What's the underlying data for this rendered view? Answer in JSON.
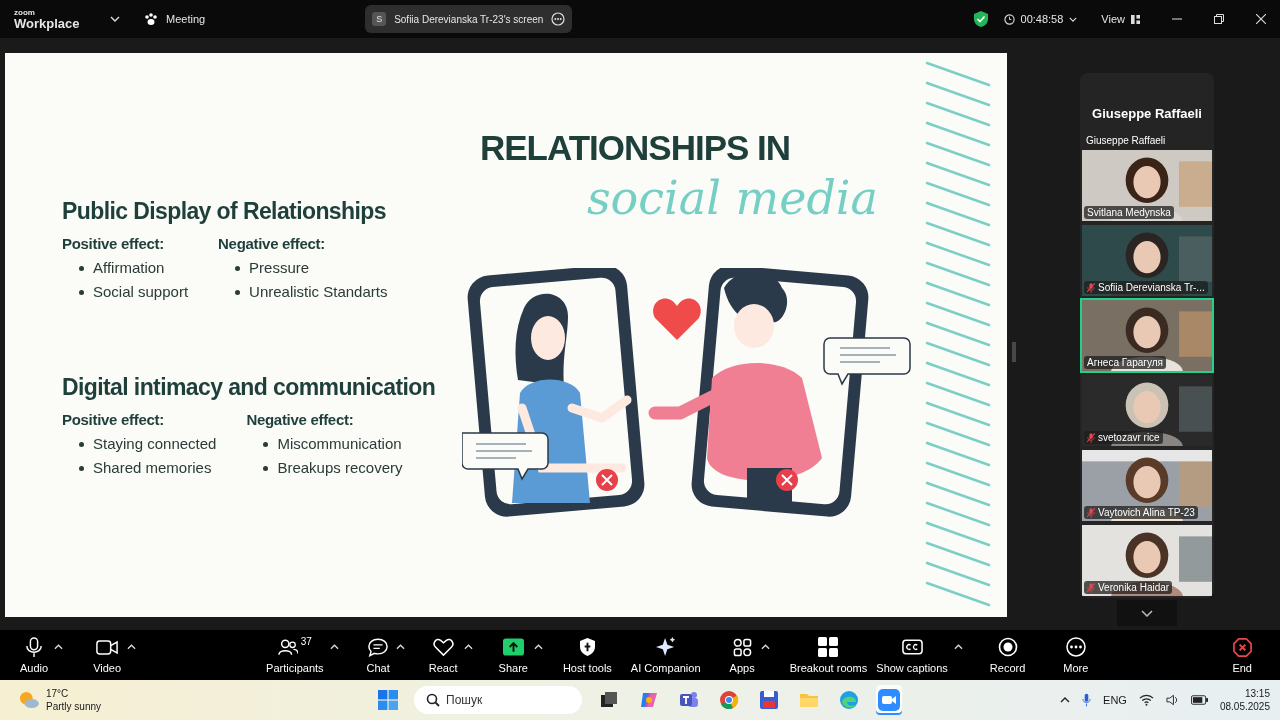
{
  "top_bar": {
    "logo_small": "zoom",
    "logo_large": "Workplace",
    "meeting": "Meeting",
    "share_pill": {
      "initial": "S",
      "label": "Sofiia Derevianska Tr-23's screen"
    },
    "timer": "00:48:58",
    "view": "View"
  },
  "slide": {
    "title": "RELATIONSHIPS IN",
    "subtitle": "social media",
    "sections": [
      {
        "heading": "Public Display of Relationships",
        "columns": [
          {
            "label": "Positive effect:",
            "items": [
              "Affirmation",
              "Social support"
            ]
          },
          {
            "label": "Negative effect:",
            "items": [
              "Pressure",
              "Unrealistic Standarts"
            ]
          }
        ]
      },
      {
        "heading": "Digital intimacy and communication",
        "columns": [
          {
            "label": "Positive effect:",
            "items": [
              "Staying connected",
              "Shared memories"
            ]
          },
          {
            "label": "Negative effect:",
            "items": [
              "Miscommunication",
              "Breakups recovery"
            ]
          }
        ]
      }
    ]
  },
  "gallery": {
    "speaker": "Giuseppe Raffaeli",
    "speaker_label": "Giuseppe Raffaeli",
    "tiles": [
      {
        "name": "Svitlana Medynska",
        "muted": false,
        "selected": false
      },
      {
        "name": "Sofiia Derevianska Tr-...",
        "muted": true,
        "selected": false
      },
      {
        "name": "Агнеса Гарагуля",
        "muted": false,
        "selected": true
      },
      {
        "name": "svetozavr rice",
        "muted": true,
        "selected": false
      },
      {
        "name": "Vaytovich Alina TP-23",
        "muted": true,
        "selected": false
      },
      {
        "name": "Veronika Haidar",
        "muted": true,
        "selected": false
      }
    ]
  },
  "toolbar": [
    {
      "kind": "mic",
      "label": "Audio",
      "caret": true
    },
    {
      "kind": "video",
      "label": "Video",
      "caret": true
    },
    {
      "kind": "participants",
      "label": "Participants",
      "count": "37",
      "caret": true
    },
    {
      "kind": "chat",
      "label": "Chat",
      "caret": true
    },
    {
      "kind": "react",
      "label": "React",
      "caret": true
    },
    {
      "kind": "share",
      "label": "Share",
      "caret": true
    },
    {
      "kind": "host",
      "label": "Host tools",
      "caret": false
    },
    {
      "kind": "ai",
      "label": "AI Companion",
      "caret": false
    },
    {
      "kind": "apps",
      "label": "Apps",
      "caret": true
    },
    {
      "kind": "breakout",
      "label": "Breakout rooms",
      "caret": false
    },
    {
      "kind": "captions",
      "label": "Show captions",
      "caret": true
    },
    {
      "kind": "record",
      "label": "Record",
      "caret": false
    },
    {
      "kind": "more",
      "label": "More",
      "caret": false
    },
    {
      "kind": "end",
      "label": "End",
      "caret": false
    }
  ],
  "taskbar": {
    "temperature": "17°C",
    "weather": "Partly sunny",
    "search_placeholder": "Пошук",
    "apps": [
      {
        "kind": "taskview",
        "selected": false
      },
      {
        "kind": "copilot",
        "selected": false
      },
      {
        "kind": "teams",
        "selected": false
      },
      {
        "kind": "chrome",
        "selected": false
      },
      {
        "kind": "save",
        "selected": false
      },
      {
        "kind": "folder",
        "selected": false
      },
      {
        "kind": "edge",
        "selected": false
      },
      {
        "kind": "zoom",
        "selected": true
      }
    ],
    "language": "ENG",
    "time": "13:15",
    "date": "08.05.2025"
  }
}
